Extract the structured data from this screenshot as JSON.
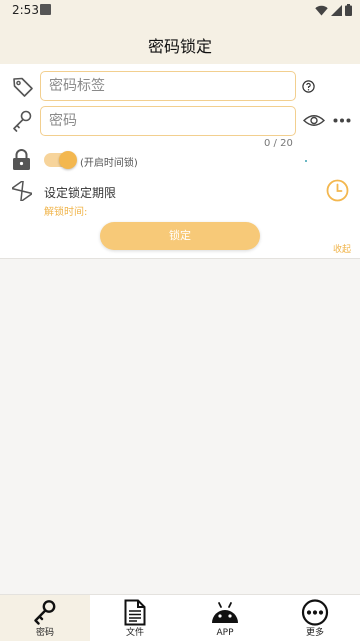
{
  "status_bar": {
    "time": "2:53"
  },
  "header": {
    "title": "密码锁定"
  },
  "form": {
    "label_placeholder": "密码标签",
    "password_placeholder": "密码",
    "password_counter": "0 / 20",
    "timer_toggle_label": "(开启时间锁)",
    "timer_toggle_on": true,
    "period_label": "设定锁定期限",
    "unlock_time_label": "解锁时间:",
    "lock_button": "锁定",
    "collapse_link": "收起"
  },
  "bottom_nav": [
    {
      "label": "密码",
      "icon": "key-icon",
      "active": true
    },
    {
      "label": "文件",
      "icon": "document-icon",
      "active": false
    },
    {
      "label": "APP",
      "icon": "android-icon",
      "active": false
    },
    {
      "label": "更多",
      "icon": "more-icon",
      "active": false
    }
  ],
  "colors": {
    "accent": "#f3b74f",
    "field_border": "#f2cf8f",
    "header_bg": "#f5f0e4"
  }
}
